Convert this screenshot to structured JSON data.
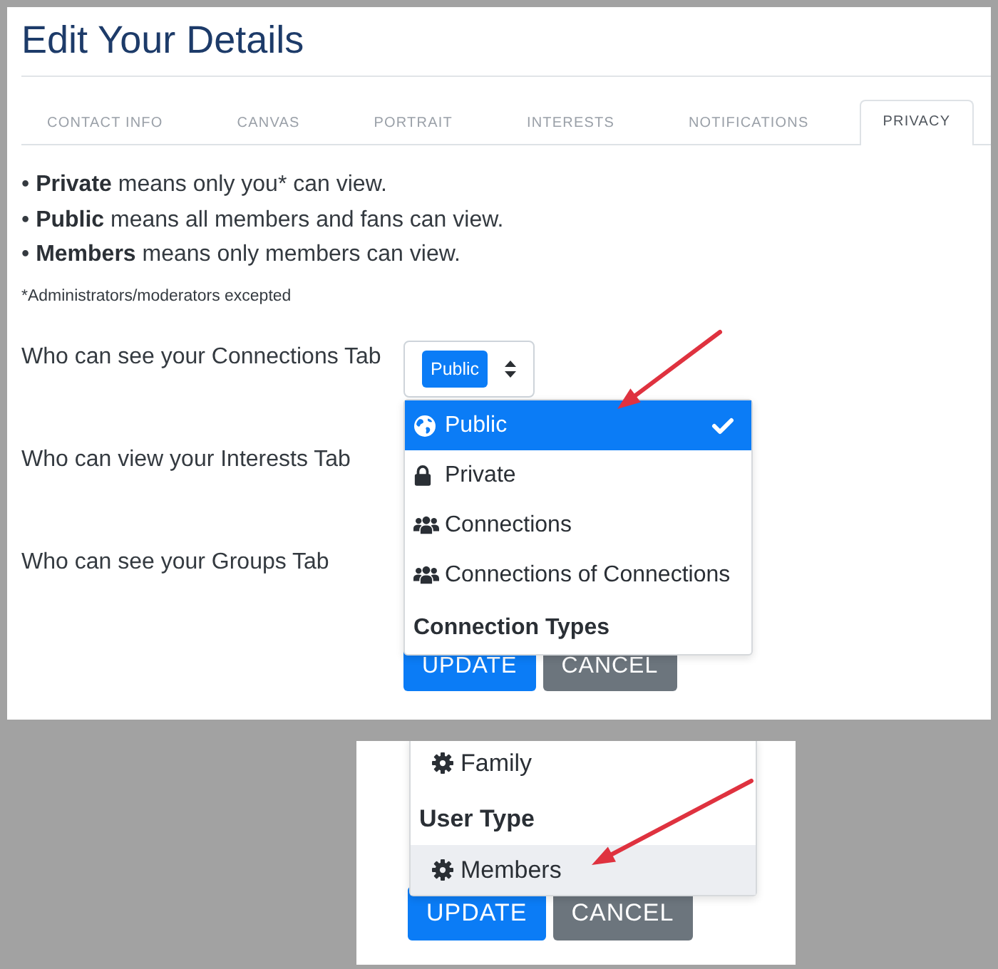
{
  "title": "Edit Your Details",
  "tabs": [
    {
      "label": "CONTACT INFO",
      "selected": false
    },
    {
      "label": "CANVAS",
      "selected": false
    },
    {
      "label": "PORTRAIT",
      "selected": false
    },
    {
      "label": "INTERESTS",
      "selected": false
    },
    {
      "label": "NOTIFICATIONS",
      "selected": false
    },
    {
      "label": "PRIVACY",
      "selected": true
    }
  ],
  "legend": [
    {
      "bullet": "•",
      "term": "Private",
      "text": "means only you* can view."
    },
    {
      "bullet": "•",
      "term": "Public",
      "text": "means all members and fans can view."
    },
    {
      "bullet": "•",
      "term": "Members",
      "text": "means only members can view."
    }
  ],
  "note": "*Administrators/moderators excepted",
  "settings": [
    {
      "label": "Who can see your Connections Tab",
      "select": {
        "value": "Public"
      }
    },
    {
      "label": "Who can view your Interests Tab"
    },
    {
      "label": "Who can see your Groups Tab"
    }
  ],
  "dropdown": {
    "items": [
      {
        "kind": "globe",
        "label": "Public",
        "selected": true
      },
      {
        "kind": "lock",
        "label": "Private",
        "selected": false
      },
      {
        "kind": "people",
        "label": "Connections",
        "selected": false
      },
      {
        "kind": "people",
        "label": "Connections of Connections",
        "selected": false
      },
      {
        "kind": "header",
        "label": "Connection Types"
      }
    ]
  },
  "buttons": [
    {
      "kind": "primary",
      "label": "UPDATE"
    },
    {
      "kind": "secondary",
      "label": "CANCEL"
    }
  ],
  "inset": {
    "menu": {
      "items": [
        {
          "kind": "gear",
          "label": "Family",
          "selected": false,
          "highlighted": false
        },
        {
          "kind": "header",
          "label": "User Type"
        },
        {
          "kind": "gear",
          "label": "Members",
          "selected": false,
          "highlighted": true
        }
      ]
    },
    "buttons": [
      {
        "kind": "primary",
        "label": "UPDATE"
      },
      {
        "kind": "secondary",
        "label": "CANCEL"
      }
    ]
  }
}
